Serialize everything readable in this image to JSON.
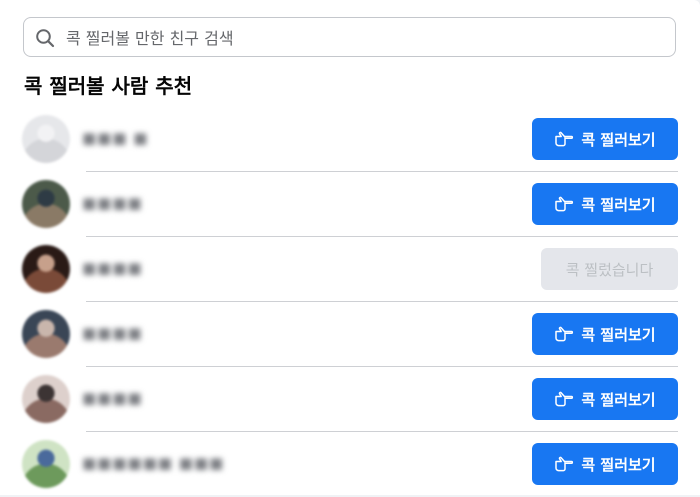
{
  "search": {
    "placeholder": "콕 찔러볼 만한 친구 검색",
    "value": ""
  },
  "section_title": "콕 찔러볼 사람 추천",
  "colors": {
    "accent": "#1877f2",
    "disabled_bg": "#e4e6eb",
    "disabled_text": "#bcc0c4"
  },
  "people": [
    {
      "name": "■■■ ■",
      "action_label": "콕 찔러보기",
      "poked": false,
      "avatar_colors": [
        "#e6e7ea",
        "#d4d5d9",
        "#f2f2f4"
      ]
    },
    {
      "name": "■■■■",
      "action_label": "콕 찔러보기",
      "poked": false,
      "avatar_colors": [
        "#4c5a4a",
        "#8a7a66",
        "#2e3b45"
      ]
    },
    {
      "name": "■■■■",
      "action_label": "콕 찔렀습니다",
      "poked": true,
      "avatar_colors": [
        "#2a1a16",
        "#7a4a38",
        "#c7a08b"
      ]
    },
    {
      "name": "■■■■",
      "action_label": "콕 찔러보기",
      "poked": false,
      "avatar_colors": [
        "#3a4656",
        "#9a7a6e",
        "#c9b6ac"
      ]
    },
    {
      "name": "■■■■",
      "action_label": "콕 찔러보기",
      "poked": false,
      "avatar_colors": [
        "#ddd0cc",
        "#8a6a62",
        "#3c3434"
      ]
    },
    {
      "name": "■■■■■■ ■■■",
      "action_label": "콕 찔러보기",
      "poked": false,
      "avatar_colors": [
        "#cfe3c4",
        "#6d9a5c",
        "#4a6a9c"
      ]
    }
  ]
}
